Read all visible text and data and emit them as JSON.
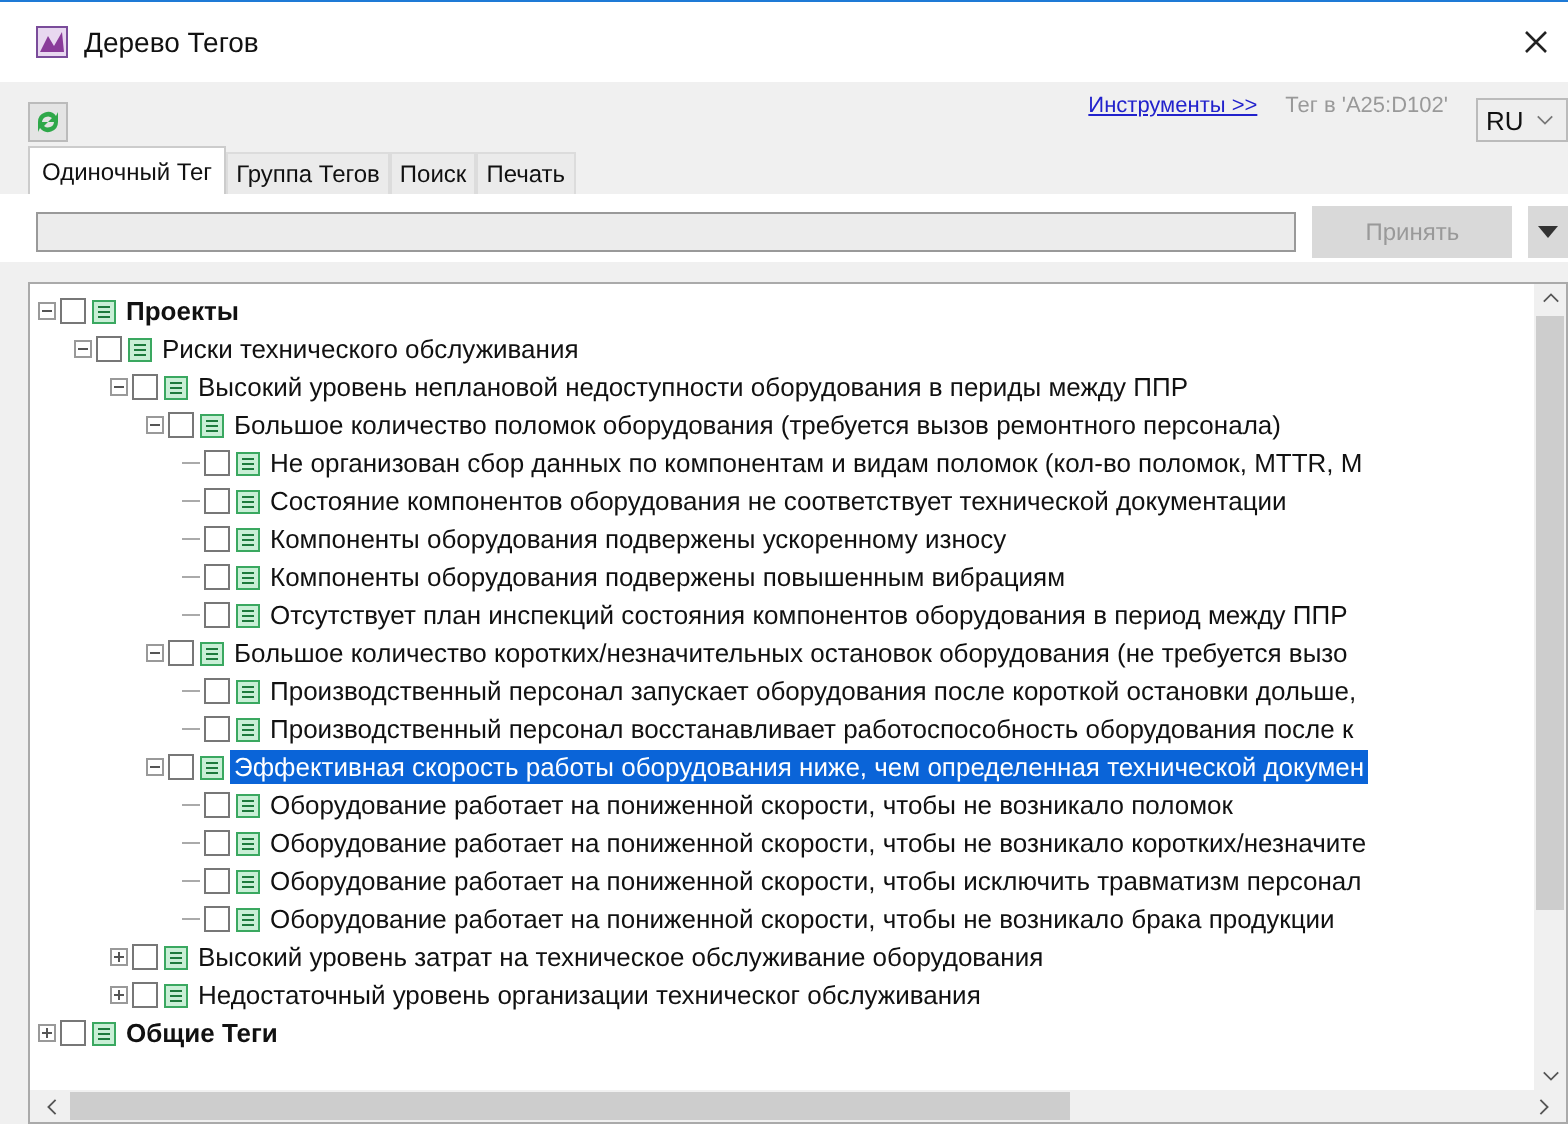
{
  "window": {
    "title": "Дерево Тегов"
  },
  "toolbar": {
    "tools_link": "Инструменты >>",
    "tag_ref": "Тег в 'A25:D102'",
    "language": "RU"
  },
  "tabs": [
    {
      "label": "Одиночный Тег",
      "selected": true
    },
    {
      "label": "Группа Тегов",
      "selected": false
    },
    {
      "label": "Поиск",
      "selected": false
    },
    {
      "label": "Печать",
      "selected": false
    }
  ],
  "accept_button": {
    "label": "Принять",
    "disabled": true
  },
  "tree": [
    {
      "kind": "folder",
      "label": "Проекты",
      "checked": false,
      "selected": false,
      "expanded": true,
      "children": [
        {
          "kind": "tag",
          "label": "Риски технического обслуживания",
          "checked": false,
          "selected": false,
          "expanded": true,
          "children": [
            {
              "kind": "tag",
              "label": "Высокий уровень неплановой недоступности оборудования в периды между ППР",
              "checked": false,
              "selected": false,
              "expanded": true,
              "children": [
                {
                  "kind": "tag",
                  "label": "Большое количество поломок оборудования (требуется вызов ремонтного персонала)",
                  "checked": false,
                  "selected": false,
                  "expanded": true,
                  "children": [
                    {
                      "kind": "tag",
                      "label": "Не организован сбор данных по компонентам и видам поломок (кол-во поломок, MTTR, M",
                      "checked": false,
                      "selected": false
                    },
                    {
                      "kind": "tag",
                      "label": "Состояние компонентов оборудования не соответствует технической документации",
                      "checked": false,
                      "selected": false
                    },
                    {
                      "kind": "tag",
                      "label": "Компоненты оборудования подвержены ускоренному износу",
                      "checked": false,
                      "selected": false
                    },
                    {
                      "kind": "tag",
                      "label": "Компоненты оборудования подвержены повышенным вибрациям",
                      "checked": false,
                      "selected": false
                    },
                    {
                      "kind": "tag",
                      "label": "Отсутствует план инспекций состояния компонентов оборудования в период между ППР",
                      "checked": false,
                      "selected": false
                    }
                  ]
                },
                {
                  "kind": "tag",
                  "label": "Большое количество коротких/незначительных остановок оборудования (не требуется вызо",
                  "checked": false,
                  "selected": false,
                  "expanded": true,
                  "children": [
                    {
                      "kind": "tag",
                      "label": "Производственный персонал запускает оборудования после короткой остановки дольше,",
                      "checked": false,
                      "selected": false
                    },
                    {
                      "kind": "tag",
                      "label": "Производственный персонал восстанавливает работоспособность оборудования после к",
                      "checked": false,
                      "selected": false
                    }
                  ]
                },
                {
                  "kind": "tag",
                  "label": "Эффективная скорость работы оборудования ниже, чем определенная технической докумен",
                  "checked": false,
                  "selected": true,
                  "expanded": true,
                  "children": [
                    {
                      "kind": "tag",
                      "label": "Оборудование работает на пониженной скорости, чтобы не возникало поломок",
                      "checked": false,
                      "selected": false
                    },
                    {
                      "kind": "tag",
                      "label": "Оборудование работает на пониженной скорости, чтобы не возникало коротких/незначите",
                      "checked": false,
                      "selected": false
                    },
                    {
                      "kind": "tag",
                      "label": "Оборудование работает на пониженной скорости, чтобы исключить травматизм персонал",
                      "checked": false,
                      "selected": false
                    },
                    {
                      "kind": "tag",
                      "label": "Оборудование работает на пониженной скорости, чтобы не возникало брака продукции",
                      "checked": false,
                      "selected": false
                    }
                  ]
                }
              ]
            },
            {
              "kind": "tag",
              "label": "Высокий уровень затрат на техническое обслуживание оборудования",
              "checked": false,
              "selected": false,
              "expanded": false
            },
            {
              "kind": "tag",
              "label": "Недостаточный уровень организации техническог обслуживания",
              "checked": false,
              "selected": false,
              "expanded": false
            }
          ]
        }
      ]
    },
    {
      "kind": "folder",
      "label": "Общие Теги",
      "checked": false,
      "selected": false,
      "expanded": false
    }
  ]
}
